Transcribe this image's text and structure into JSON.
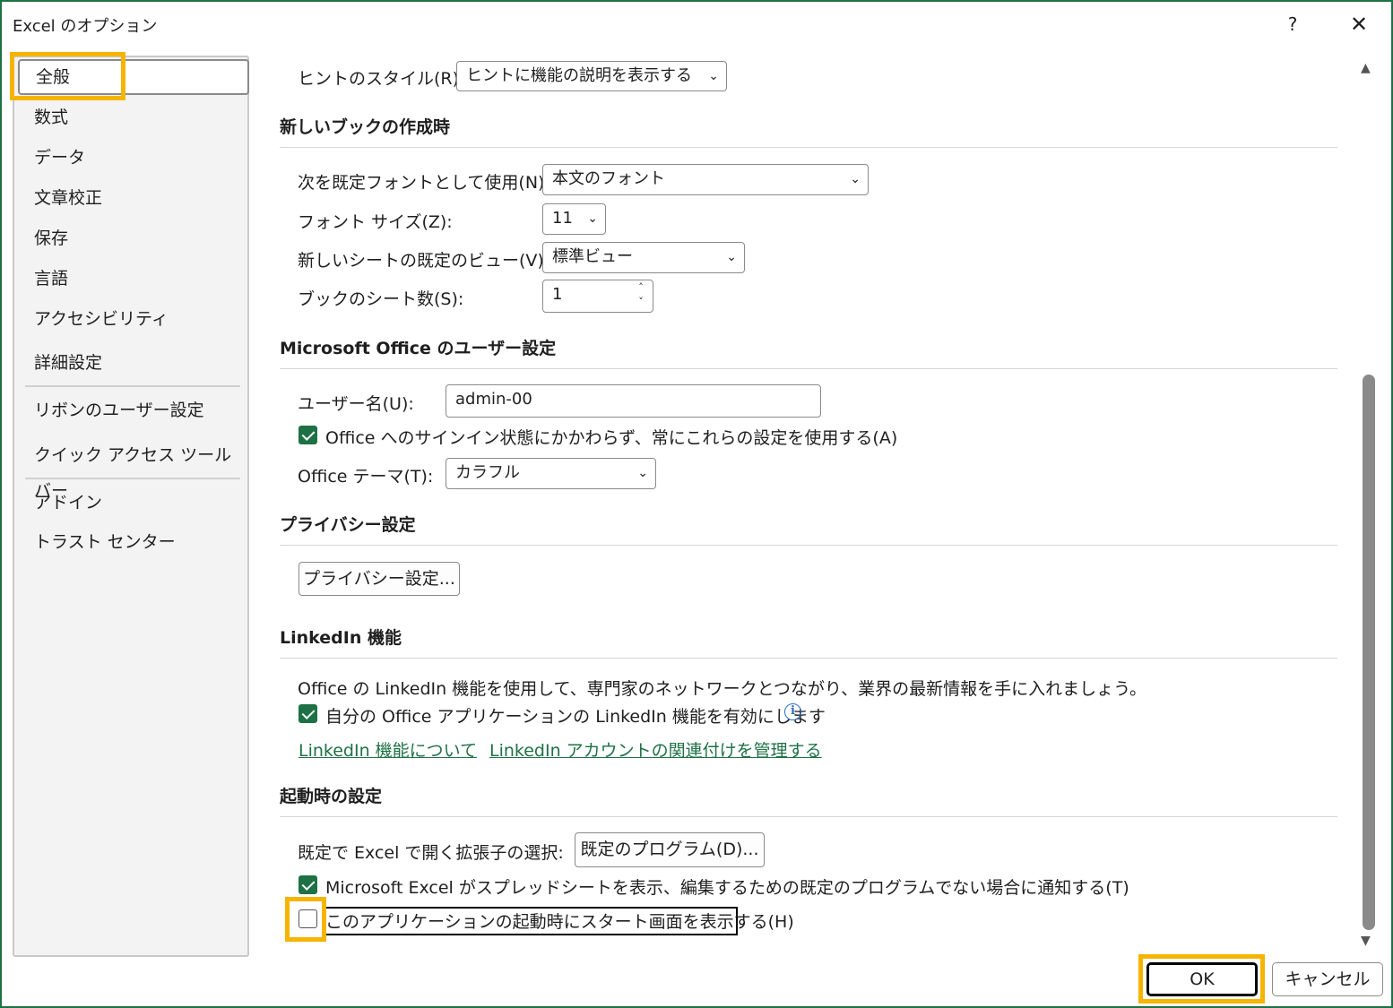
{
  "window": {
    "title": "Excel のオプション",
    "help": "?",
    "close": "✕"
  },
  "sidebar": {
    "items": [
      {
        "label": "全般",
        "selected": true
      },
      {
        "label": "数式"
      },
      {
        "label": "データ"
      },
      {
        "label": "文章校正"
      },
      {
        "label": "保存"
      },
      {
        "label": "言語"
      },
      {
        "label": "アクセシビリティ"
      },
      {
        "label": "詳細設定"
      },
      {
        "label": "リボンのユーザー設定"
      },
      {
        "label": "クイック アクセス ツール バー"
      },
      {
        "label": "アドイン"
      },
      {
        "label": "トラスト センター"
      }
    ]
  },
  "main": {
    "hint_style": {
      "label": "ヒントのスタイル(R):",
      "value": "ヒントに機能の説明を表示する"
    },
    "new_book": {
      "title": "新しいブックの作成時",
      "default_font": {
        "label": "次を既定フォントとして使用(N):",
        "value": "本文のフォント"
      },
      "font_size": {
        "label": "フォント サイズ(Z):",
        "value": "11"
      },
      "default_view": {
        "label": "新しいシートの既定のビュー(V):",
        "value": "標準ビュー"
      },
      "sheet_count": {
        "label": "ブックのシート数(S):",
        "value": "1"
      }
    },
    "user_settings": {
      "title": "Microsoft Office のユーザー設定",
      "username": {
        "label": "ユーザー名(U):",
        "value": "admin-00"
      },
      "always_use": {
        "label": "Office へのサインイン状態にかかわらず、常にこれらの設定を使用する(A)",
        "checked": true
      },
      "theme": {
        "label": "Office テーマ(T):",
        "value": "カラフル"
      }
    },
    "privacy": {
      "title": "プライバシー設定",
      "button": "プライバシー設定..."
    },
    "linkedin": {
      "title": "LinkedIn 機能",
      "description": "Office の LinkedIn 機能を使用して、専門家のネットワークとつながり、業界の最新情報を手に入れましょう。",
      "enable": {
        "label": "自分の Office アプリケーションの LinkedIn 機能を有効にします",
        "checked": true
      },
      "info_icon": "i",
      "link_about": "LinkedIn 機能について",
      "link_manage": "LinkedIn アカウントの関連付けを管理する"
    },
    "startup": {
      "title": "起動時の設定",
      "ext_label": "既定で Excel で開く拡張子の選択:",
      "default_programs_button": "既定のプログラム(D)...",
      "notify": {
        "label": "Microsoft Excel がスプレッドシートを表示、編集するための既定のプログラムでない場合に通知する(T)",
        "checked": true
      },
      "show_start": {
        "label": "このアプリケーションの起動時にスタート画面を表示する(H)",
        "checked": false
      }
    }
  },
  "footer": {
    "ok": "OK",
    "cancel": "キャンセル"
  },
  "icons": {
    "chevron": "⌄",
    "spin_up": "˄",
    "spin_down": "˅",
    "scroll_up": "▲",
    "scroll_down": "▼"
  },
  "colors": {
    "accent": "#1e7145",
    "highlight": "#f5b400",
    "link": "#1e7145"
  }
}
